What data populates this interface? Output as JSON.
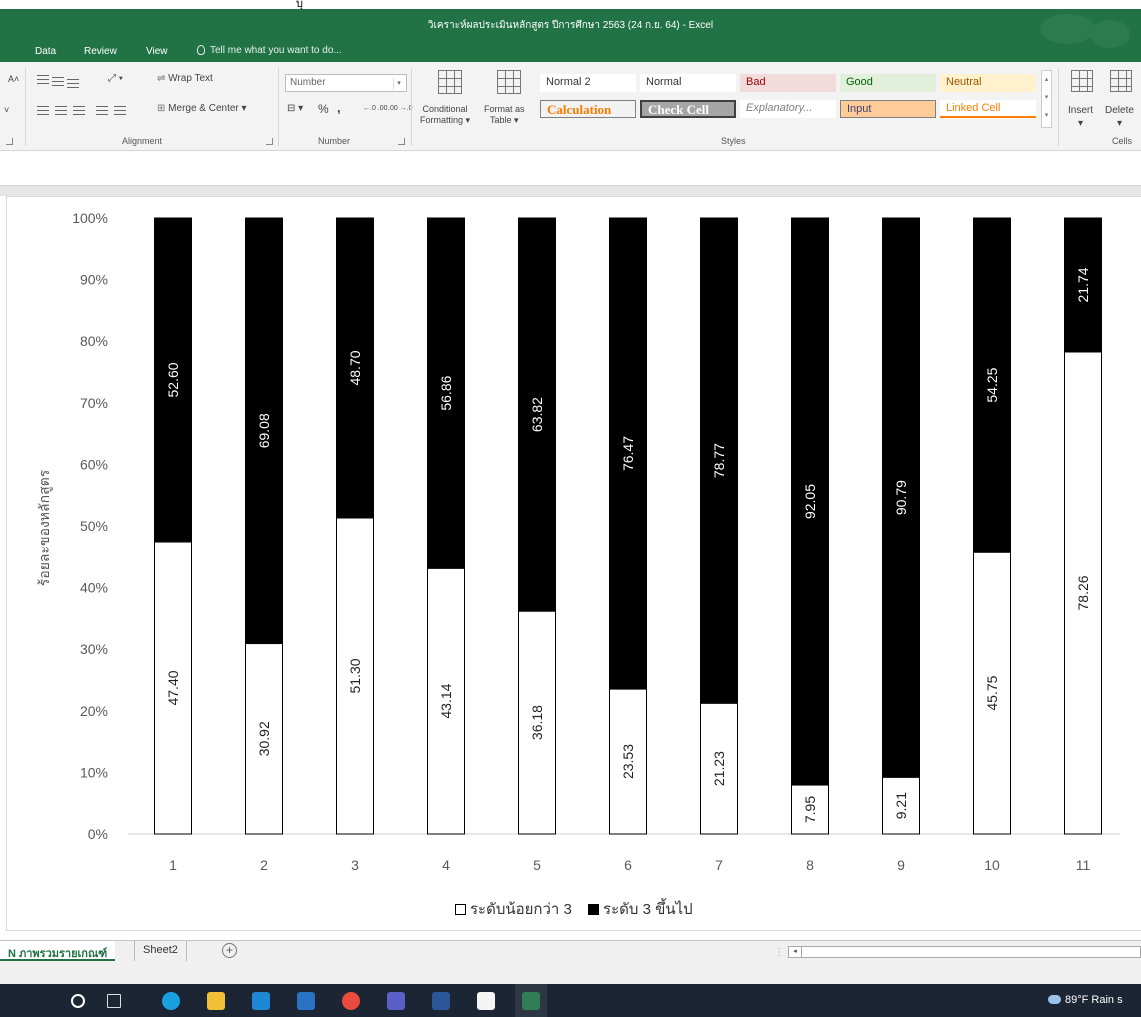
{
  "window": {
    "title": "วิเคราะห์ผลประเมินหลักสูตร ปีการศึกษา 2563 (24 ก.ย. 64) - Excel",
    "top_strip_text": "บุ",
    "accent_color": "#217346"
  },
  "menu": {
    "tabs": [
      "Data",
      "Review",
      "View"
    ],
    "tell_me": "Tell me what you want to do..."
  },
  "ribbon": {
    "alignment": {
      "wrap_text": "Wrap Text",
      "merge_center": "Merge & Center",
      "label": "Alignment"
    },
    "number": {
      "format": "Number",
      "percent": "%",
      "comma": ",",
      "inc_decimal": "←.0 .00",
      "dec_decimal": ".00 →.0",
      "label": "Number"
    },
    "conditional_formatting": {
      "line1": "Conditional",
      "line2": "Formatting"
    },
    "format_as_table": {
      "line1": "Format as",
      "line2": "Table"
    },
    "styles": {
      "label": "Styles",
      "row1": [
        "Normal 2",
        "Normal",
        "Bad",
        "Good",
        "Neutral"
      ],
      "row2": [
        "Calculation",
        "Check Cell",
        "Explanatory...",
        "Input",
        "Linked Cell"
      ]
    },
    "cells": {
      "insert": "Insert",
      "delete": "Delete",
      "label": "Cells"
    }
  },
  "sheets": {
    "tabs": [
      "N ภาพรวมรายเกณฑ์",
      "Sheet2"
    ],
    "active_index": 0,
    "add_symbol": "+"
  },
  "taskbar": {
    "weather": "89°F  Rain s"
  },
  "chart_data": {
    "type": "bar",
    "stacked": "percent",
    "categories": [
      "1",
      "2",
      "3",
      "4",
      "5",
      "6",
      "7",
      "8",
      "9",
      "10",
      "11"
    ],
    "series": [
      {
        "name": "ระดับน้อยกว่า 3",
        "color": "#ffffff",
        "values": [
          47.4,
          30.92,
          51.3,
          43.14,
          36.18,
          23.53,
          21.23,
          7.95,
          9.21,
          45.75,
          78.26
        ],
        "labels": [
          "47.40",
          "30.92",
          "51.30",
          "43.14",
          "36.18",
          "23.53",
          "21.23",
          "7.95",
          "9.21",
          "45.75",
          "78.26"
        ]
      },
      {
        "name": "ระดับ 3 ขึ้นไป",
        "color": "#000000",
        "values": [
          52.6,
          69.08,
          48.7,
          56.86,
          63.82,
          76.47,
          78.77,
          92.05,
          90.79,
          54.25,
          21.74
        ],
        "labels": [
          "52.60",
          "69.08",
          "48.70",
          "56.86",
          "63.82",
          "76.47",
          "78.77",
          "92.05",
          "90.79",
          "54.25",
          "21.74"
        ]
      }
    ],
    "ylabel": "ร้อยละของหลักสูตร",
    "xlabel": "",
    "ylim": [
      0,
      100
    ],
    "yticks": [
      "0%",
      "10%",
      "20%",
      "30%",
      "40%",
      "50%",
      "60%",
      "70%",
      "80%",
      "90%",
      "100%"
    ],
    "grid": false,
    "legend": "bottom"
  }
}
